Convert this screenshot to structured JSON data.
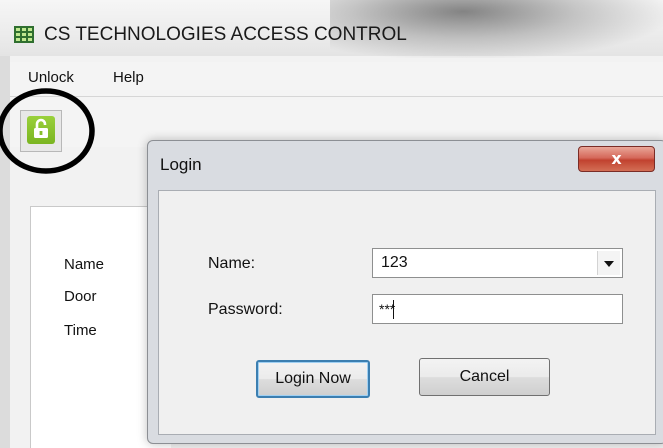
{
  "window": {
    "title": "CS TECHNOLOGIES ACCESS CONTROL",
    "icon": "grid-app-icon"
  },
  "menu": {
    "items": [
      "Unlock",
      "Help"
    ]
  },
  "toolbar": {
    "lock_icon": "unlocked-padlock-icon",
    "lock_color": "#8cc631"
  },
  "info_panel": {
    "labels": [
      "Name",
      "Door",
      "Time"
    ]
  },
  "login_dialog": {
    "title": "Login",
    "close_label": "x",
    "name_label": "Name:",
    "name_value": "123",
    "password_label": "Password:",
    "password_value": "***",
    "login_button": "Login Now",
    "cancel_button": "Cancel"
  },
  "colors": {
    "close_button": "#c8463a",
    "default_button_border": "#3c7fb1",
    "annotation_circle": "#000000"
  }
}
